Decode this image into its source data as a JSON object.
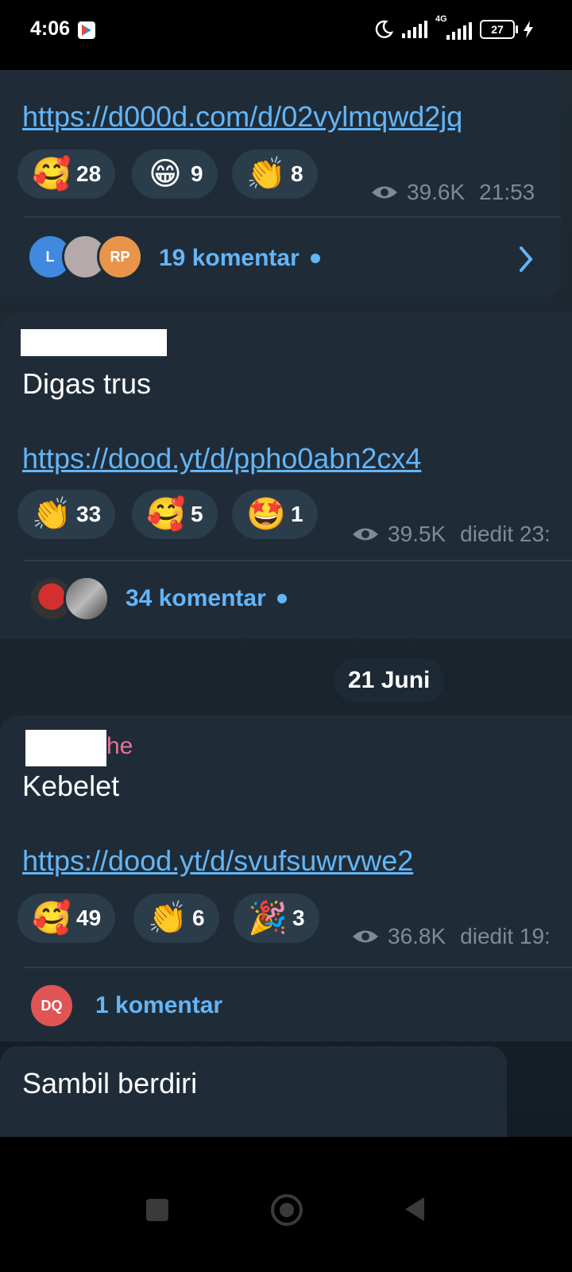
{
  "status_bar": {
    "time": "4:06",
    "network": "4G",
    "battery": "27"
  },
  "messages": [
    {
      "link": "https://d000d.com/d/02vylmqwd2jq",
      "reactions": [
        {
          "emoji": "🥰",
          "count": "28"
        },
        {
          "emoji": "😁",
          "count": "9"
        },
        {
          "emoji": "👏",
          "count": "8"
        }
      ],
      "views": "39.6K",
      "time": "21:53",
      "avatars": [
        "L",
        "",
        "RP"
      ],
      "comments": "19 komentar"
    },
    {
      "text": "Digas trus",
      "link": "https://dood.yt/d/ppho0abn2cx4",
      "reactions": [
        {
          "emoji": "👏",
          "count": "33"
        },
        {
          "emoji": "🥰",
          "count": "5"
        },
        {
          "emoji": "🤩",
          "count": "1"
        }
      ],
      "views": "39.5K",
      "time": "diedit 23:",
      "comments": "34 komentar"
    },
    {
      "sender_suffix": "he",
      "text": "Kebelet",
      "link": "https://dood.yt/d/svufsuwrvwe2",
      "reactions": [
        {
          "emoji": "🥰",
          "count": "49"
        },
        {
          "emoji": "👏",
          "count": "6"
        },
        {
          "emoji": "🎉",
          "count": "3"
        }
      ],
      "views": "36.8K",
      "time": "diedit 19:",
      "avatars": [
        "DQ"
      ],
      "comments": "1 komentar"
    },
    {
      "text": "Sambil berdiri"
    }
  ],
  "date_separator": "21 Juni",
  "colors": {
    "link": "#64b5f6",
    "bubble": "#1f2c38",
    "reaction": "#2b3c4b",
    "sender": "#e57398"
  }
}
